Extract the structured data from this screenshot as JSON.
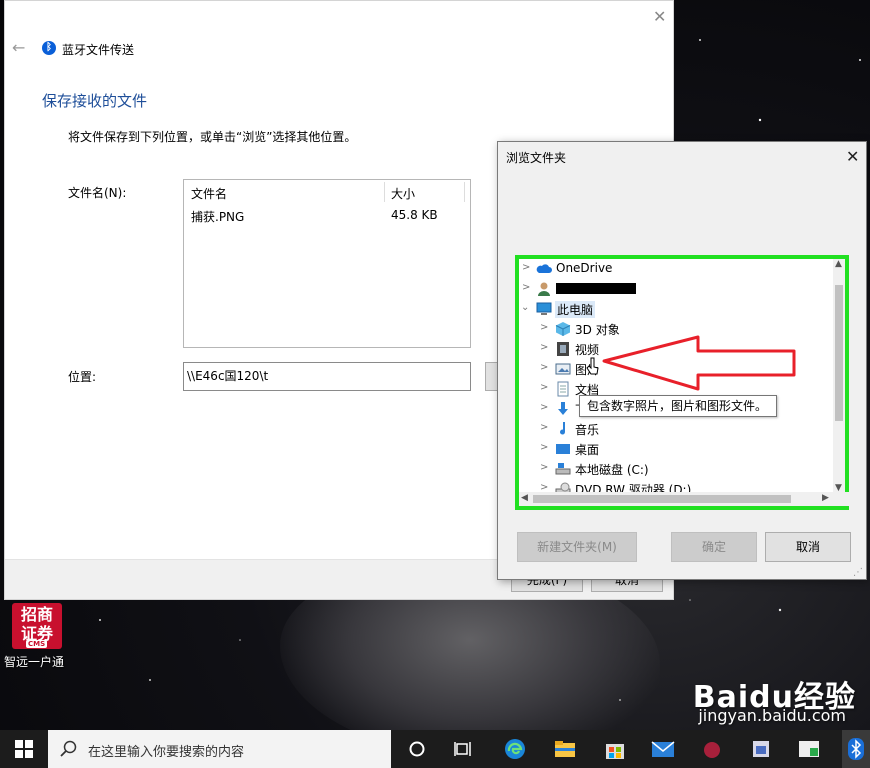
{
  "main_window": {
    "title": "蓝牙文件传送",
    "heading": "保存接收的文件",
    "description": "将文件保存到下列位置，或单击“浏览”选择其他位置。",
    "filename_label": "文件名(N):",
    "columns": [
      "文件名",
      "大小"
    ],
    "files": [
      {
        "name": "捕获.PNG",
        "size": "45.8 KB"
      }
    ],
    "location_label": "位置:",
    "location_value": "\\\\E46c国120\\t",
    "finish_button": "完成(F)",
    "cancel_button": "取消"
  },
  "dialog": {
    "title": "浏览文件夹",
    "tree": [
      {
        "label": "OneDrive",
        "icon": "cloud-icon",
        "level": 0,
        "expand": "collapsed"
      },
      {
        "label": "",
        "icon": "user-icon",
        "level": 0,
        "expand": "collapsed",
        "redacted": true
      },
      {
        "label": "此电脑",
        "icon": "computer-icon",
        "level": 0,
        "expand": "expanded",
        "selected": true
      },
      {
        "label": "3D 对象",
        "icon": "cube-icon",
        "level": 1,
        "expand": "collapsed"
      },
      {
        "label": "视频",
        "icon": "film-icon",
        "level": 1,
        "expand": "collapsed"
      },
      {
        "label": "图片",
        "icon": "picture-icon",
        "level": 1,
        "expand": "collapsed"
      },
      {
        "label": "文档",
        "icon": "document-icon",
        "level": 1,
        "expand": "collapsed"
      },
      {
        "label": "下载",
        "icon": "download-icon",
        "level": 1,
        "expand": "collapsed"
      },
      {
        "label": "音乐",
        "icon": "music-icon",
        "level": 1,
        "expand": "collapsed"
      },
      {
        "label": "桌面",
        "icon": "desktop-icon",
        "level": 1,
        "expand": "collapsed"
      },
      {
        "label": "本地磁盘 (C:)",
        "icon": "disk-icon",
        "level": 1,
        "expand": "collapsed"
      },
      {
        "label": "DVD RW 驱动器 (D:)",
        "icon": "dvd-icon",
        "level": 1,
        "expand": "collapsed"
      }
    ],
    "tooltip": "包含数字照片，图片和图形文件。",
    "new_folder_button": "新建文件夹(M)",
    "ok_button": "确定",
    "cancel_button": "取消"
  },
  "desktop": {
    "icon_text": "招商证券",
    "icon_badge": "CMS",
    "icon_label": "智远一户通"
  },
  "taskbar": {
    "search_placeholder": "在这里输入你要搜索的内容"
  },
  "watermark": {
    "brand": "Baidu经验",
    "url": "jingyan.baidu.com"
  },
  "colors": {
    "heading_blue": "#1e4e99",
    "highlight_green": "#21e021",
    "arrow_red": "#e8202a",
    "taskbar": "#1c1c1c"
  }
}
